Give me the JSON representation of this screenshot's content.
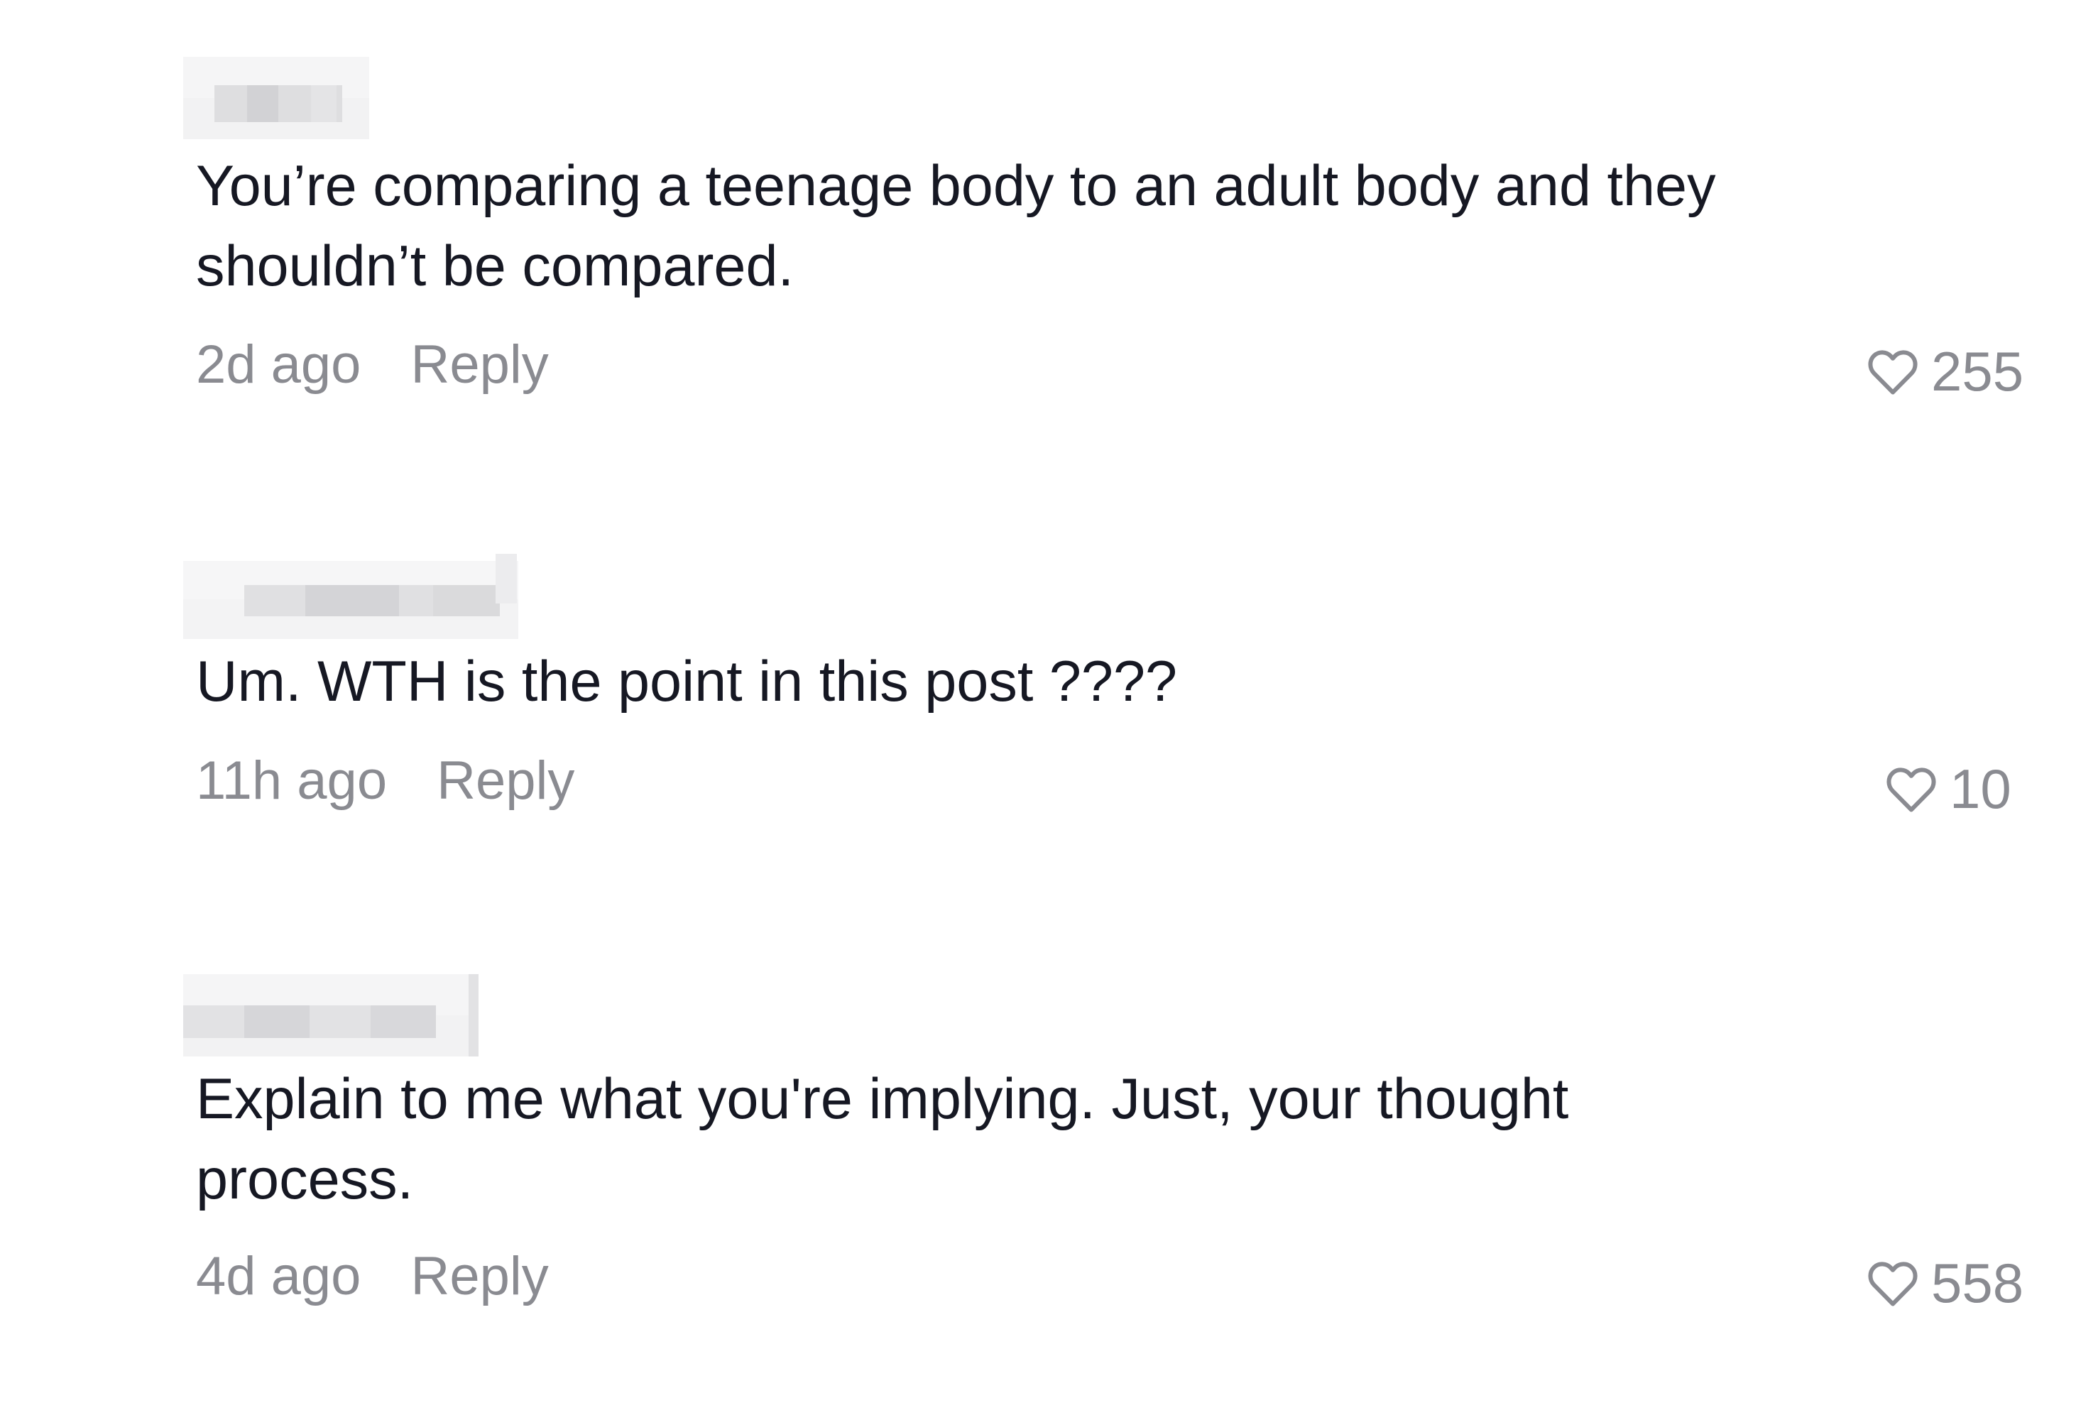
{
  "comments": [
    {
      "text": "You’re comparing a teenage body to an adult body and they shouldn’t be compared.",
      "time": "2d ago",
      "reply_label": "Reply",
      "likes": "255"
    },
    {
      "text": "Um. WTH is the point in this post ????",
      "time": "11h ago",
      "reply_label": "Reply",
      "likes": "10"
    },
    {
      "text": "Explain to me what you're implying. Just, your thought process.",
      "time": "4d ago",
      "reply_label": "Reply",
      "likes": "558"
    }
  ],
  "icons": {
    "like": "heart-outline-icon"
  },
  "colors": {
    "text": "#161823",
    "secondary": "#8a8b91",
    "background": "#ffffff"
  }
}
